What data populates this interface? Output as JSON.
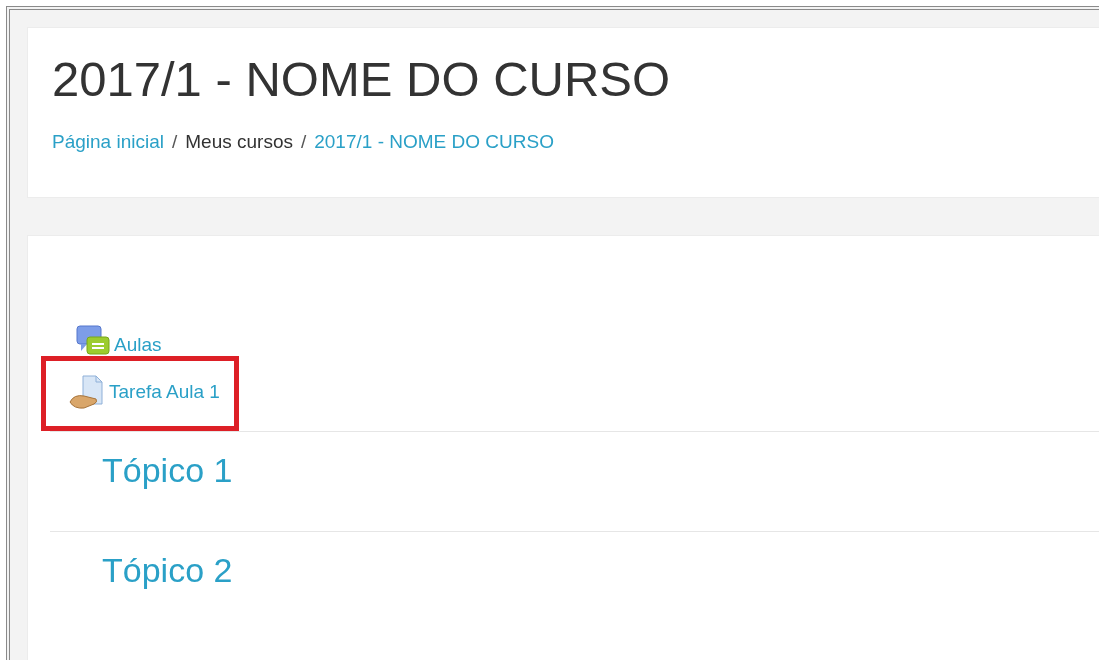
{
  "header": {
    "title": "2017/1 - NOME DO CURSO",
    "breadcrumb": [
      {
        "label": "Página inicial",
        "link": true
      },
      {
        "separator": "/",
        "label": "Meus cursos",
        "link": false
      },
      {
        "separator": "/",
        "label": "2017/1 - NOME DO CURSO",
        "link": true
      }
    ]
  },
  "activities": [
    {
      "kind": "forum",
      "label": "Aulas",
      "highlighted": false
    },
    {
      "kind": "assign",
      "label": "Tarefa Aula 1",
      "highlighted": true
    }
  ],
  "topics": [
    {
      "title": "Tópico 1"
    },
    {
      "title": "Tópico 2"
    }
  ]
}
